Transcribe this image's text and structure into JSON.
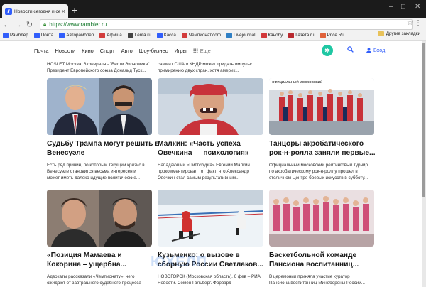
{
  "browser": {
    "tab_title": "Новости сегодня и сейчас",
    "tab_favicon": "rambler-favicon",
    "url": "https://www.rambler.ru"
  },
  "bookmarks": [
    {
      "label": "Рамблер",
      "color": "#315efb",
      "icon": "rambler-icon"
    },
    {
      "label": "Почта",
      "color": "#315efb",
      "icon": "mail-icon"
    },
    {
      "label": "Авторамблер",
      "color": "#315efb",
      "icon": "auto-icon"
    },
    {
      "label": "Афиша",
      "color": "#d23c3c",
      "icon": "afisha-icon"
    },
    {
      "label": "Lenta.ru",
      "color": "#444444",
      "icon": "lenta-icon"
    },
    {
      "label": "Касса",
      "color": "#315efb",
      "icon": "kassa-icon"
    },
    {
      "label": "Чемпионат.com",
      "color": "#d23c3c",
      "icon": "championat-icon"
    },
    {
      "label": "Livejournal",
      "color": "#2f7fc4",
      "icon": "livejournal-icon"
    },
    {
      "label": "Канобу",
      "color": "#d2383a",
      "icon": "kanobu-icon"
    },
    {
      "label": "Газета.ru",
      "color": "#b8292f",
      "icon": "gazeta-icon"
    },
    {
      "label": "Price.Ru",
      "color": "#e0623a",
      "icon": "price-icon"
    }
  ],
  "other_bookmarks": "Другие закладки",
  "nav": {
    "items": [
      "Почта",
      "Новости",
      "Кино",
      "Спорт",
      "Авто",
      "Шоу-бизнес",
      "Игры"
    ],
    "more": "Еще",
    "login": "Вход"
  },
  "snippets_top": [
    {
      "line1": "HOSLET Москва, 6 февраля - \"Вести.Экономика\".",
      "line2": "Президент Европейского союза Дональд Туск..."
    },
    {
      "line1": "саммит США и КНДР может придать импульс",
      "line2": "примирению двух стран, хотя америк..."
    }
  ],
  "cards": [
    {
      "title_1": "Судьбу Трампа могут решить в",
      "title_2": "Венесуэле",
      "text_1": "Есть ряд причин, по которым текущий кризис в",
      "text_2": "Венесуэле становится весьма интересен и",
      "text_3": "может иметь далеко идущие политические..."
    },
    {
      "title_1": "Малкин: «Часть успеха",
      "title_2": "Овечкина — психология»",
      "text_1": "Нападающий «Питтсбурга» Евгений Малкин",
      "text_2": "прокомментировал тот факт, что Александр",
      "text_3": "Овечкин стал самым результативным..."
    },
    {
      "title_1": "Танцоры акробатического",
      "title_2": "рок-н-ролла заняли первые...",
      "text_1": "Официальный московский рейтинговый турнир",
      "text_2": "по акробатическому рок-н-роллу прошел в",
      "text_3": "столичном Центре боевых искусств в субботу..."
    },
    {
      "title_1": "«Позиция Мамаева и",
      "title_2": "Кокорина – ущербна...",
      "text_1": "Адвокаты рассказали «Чемпионату», чего",
      "text_2": "ожидают от завтрашнего судебного процесса"
    },
    {
      "title_1": "Кузьменко: о вызове в",
      "title_2": "сборную России Светлаков...",
      "text_1": "НОВОГОРСК (Московская область), 6 фев – РИА",
      "text_2": "Новости. Семён Гальберг. Форвард"
    },
    {
      "title_1": "Баскетбольной команде",
      "title_2": "Пансиона воспитанниц...",
      "text_1": "В церемонии приняла участие куратор",
      "text_2": "Пансиона воспитанниц Минобороны России..."
    }
  ],
  "img4_caption": "ОФИЦИАЛЬНЫЙ МОСКОВСКИЙ",
  "watermark": "ЮХЕЛП"
}
